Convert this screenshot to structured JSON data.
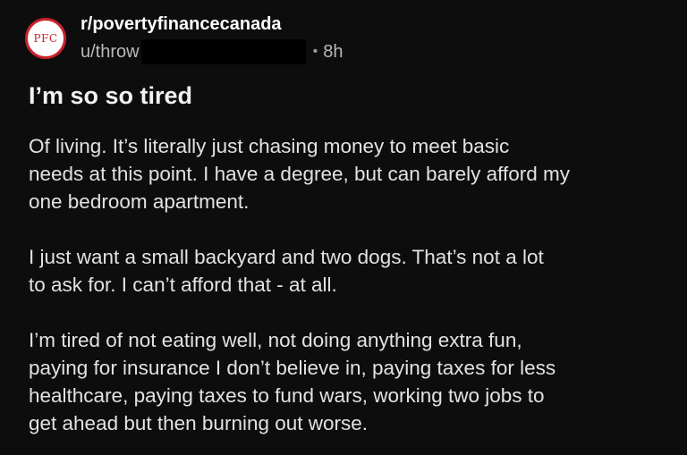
{
  "post": {
    "avatar_text": "PFC",
    "subreddit": "r/povertyfinancecanada",
    "username": "u/throw",
    "separator": "•",
    "age": "8h",
    "title": "I’m so so tired",
    "paragraphs": [
      [
        "Of living. It’s literally just chasing money to meet basic",
        "needs at this point. I have a degree, but can barely afford my",
        "one bedroom apartment."
      ],
      [
        "I just want a small backyard and two dogs. That’s not a lot",
        "to ask for. I can’t afford that - at all."
      ],
      [
        "I’m tired of not eating well, not doing anything extra fun,",
        "paying for insurance I don’t believe in, paying taxes for less",
        "healthcare, paying taxes to fund wars, working two jobs to",
        "get ahead but then burning out worse."
      ]
    ]
  },
  "colors": {
    "background": "#0d0d0d",
    "avatar_accent": "#c8232c",
    "text_primary": "#e6e6e6",
    "text_secondary": "#b9b9b9"
  }
}
